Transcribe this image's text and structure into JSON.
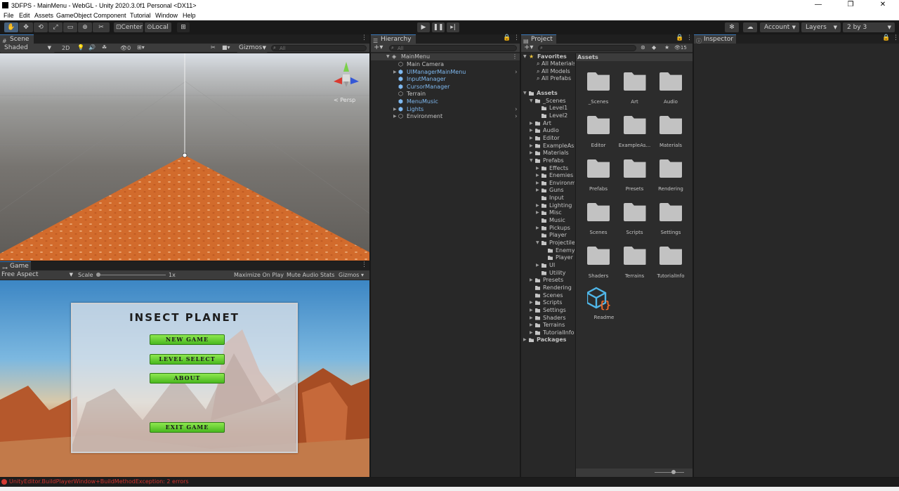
{
  "window": {
    "title": "3DFPS - MainMenu - WebGL - Unity 2020.3.0f1 Personal <DX11>",
    "minimize": "—",
    "maximize": "❐",
    "close": "✕"
  },
  "menu": [
    "File",
    "Edit",
    "Assets",
    "GameObject",
    "Component",
    "Tutorial",
    "Window",
    "Help"
  ],
  "toolbar": {
    "pivot": "Center",
    "space": "Local",
    "account": "Account",
    "layers": "Layers",
    "layout": "2 by 3"
  },
  "scene": {
    "tab": "Scene",
    "shading": "Shaded",
    "mode2d": "2D",
    "fx_count": "0",
    "gizmos": "Gizmos",
    "search_placeholder": "All",
    "persp_label": "< Persp"
  },
  "game": {
    "tab": "Game",
    "aspect": "Free Aspect",
    "scale_label": "Scale",
    "scale_value": "1x",
    "maximize": "Maximize On Play",
    "mute": "Mute Audio",
    "stats": "Stats",
    "gizmos": "Gizmos",
    "title": "INSECT PLANET",
    "buttons": [
      "NEW GAME",
      "LEVEL SELECT",
      "ABOUT",
      "EXIT GAME"
    ]
  },
  "hierarchy": {
    "tab": "Hierarchy",
    "search_placeholder": "All",
    "root": "MainMenu",
    "items": [
      {
        "label": "Main Camera",
        "prefab": false,
        "expandable": false
      },
      {
        "label": "UIManagerMainMenu",
        "prefab": true,
        "expandable": true
      },
      {
        "label": "InputManager",
        "prefab": true,
        "expandable": false
      },
      {
        "label": "CursorManager",
        "prefab": true,
        "expandable": false
      },
      {
        "label": "Terrain",
        "prefab": false,
        "expandable": false
      },
      {
        "label": "MenuMusic",
        "prefab": true,
        "expandable": false
      },
      {
        "label": "Lights",
        "prefab": true,
        "expandable": true
      },
      {
        "label": "Environment",
        "prefab": false,
        "expandable": true
      }
    ]
  },
  "project": {
    "tab": "Project",
    "hidden_count": "15",
    "favorites": {
      "label": "Favorites",
      "items": [
        "All Materials",
        "All Models",
        "All Prefabs"
      ]
    },
    "tree": [
      {
        "label": "Assets",
        "depth": 0,
        "arrow": "open",
        "bold": true
      },
      {
        "label": "_Scenes",
        "depth": 1,
        "arrow": "open"
      },
      {
        "label": "Level1",
        "depth": 2,
        "arrow": ""
      },
      {
        "label": "Level2",
        "depth": 2,
        "arrow": ""
      },
      {
        "label": "Art",
        "depth": 1,
        "arrow": "closed"
      },
      {
        "label": "Audio",
        "depth": 1,
        "arrow": "closed"
      },
      {
        "label": "Editor",
        "depth": 1,
        "arrow": "closed"
      },
      {
        "label": "ExampleAss",
        "depth": 1,
        "arrow": "closed"
      },
      {
        "label": "Materials",
        "depth": 1,
        "arrow": "closed"
      },
      {
        "label": "Prefabs",
        "depth": 1,
        "arrow": "open"
      },
      {
        "label": "Effects",
        "depth": 2,
        "arrow": "closed"
      },
      {
        "label": "Enemies",
        "depth": 2,
        "arrow": "closed"
      },
      {
        "label": "Environm",
        "depth": 2,
        "arrow": "closed"
      },
      {
        "label": "Guns",
        "depth": 2,
        "arrow": "closed"
      },
      {
        "label": "Input",
        "depth": 2,
        "arrow": ""
      },
      {
        "label": "Lighting",
        "depth": 2,
        "arrow": "closed"
      },
      {
        "label": "Misc",
        "depth": 2,
        "arrow": "closed"
      },
      {
        "label": "Music",
        "depth": 2,
        "arrow": ""
      },
      {
        "label": "Pickups",
        "depth": 2,
        "arrow": "closed"
      },
      {
        "label": "Player",
        "depth": 2,
        "arrow": ""
      },
      {
        "label": "Projectile",
        "depth": 2,
        "arrow": "open"
      },
      {
        "label": "Enemy",
        "depth": 3,
        "arrow": ""
      },
      {
        "label": "Player",
        "depth": 3,
        "arrow": ""
      },
      {
        "label": "UI",
        "depth": 2,
        "arrow": "closed"
      },
      {
        "label": "Utility",
        "depth": 2,
        "arrow": ""
      },
      {
        "label": "Presets",
        "depth": 1,
        "arrow": "closed"
      },
      {
        "label": "Rendering",
        "depth": 1,
        "arrow": ""
      },
      {
        "label": "Scenes",
        "depth": 1,
        "arrow": ""
      },
      {
        "label": "Scripts",
        "depth": 1,
        "arrow": "closed"
      },
      {
        "label": "Settings",
        "depth": 1,
        "arrow": "closed"
      },
      {
        "label": "Shaders",
        "depth": 1,
        "arrow": "closed"
      },
      {
        "label": "Terrains",
        "depth": 1,
        "arrow": "closed"
      },
      {
        "label": "TutorialInfo",
        "depth": 1,
        "arrow": "closed"
      },
      {
        "label": "Packages",
        "depth": 0,
        "arrow": "closed",
        "bold": true
      }
    ],
    "breadcrumb": "Assets",
    "grid": [
      "_Scenes",
      "Art",
      "Audio",
      "Editor",
      "ExampleAs...",
      "Materials",
      "Prefabs",
      "Presets",
      "Rendering",
      "Scenes",
      "Scripts",
      "Settings",
      "Shaders",
      "Terrains",
      "TutorialInfo"
    ],
    "readme": "Readme"
  },
  "inspector": {
    "tab": "Inspector"
  },
  "status": {
    "error": "UnityEditor.BuildPlayerWindow+BuildMethodException: 2 errors"
  }
}
